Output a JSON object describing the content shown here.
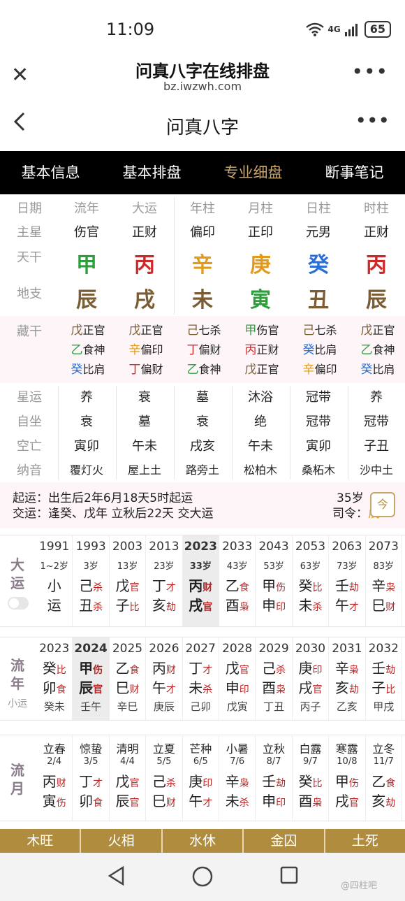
{
  "status": {
    "time": "11:09",
    "signal": "4G",
    "battery": "65"
  },
  "browser": {
    "title": "问真八字在线排盘",
    "url": "bz.iwzwh.com"
  },
  "appbar": {
    "title": "问真八字"
  },
  "tabs": [
    "基本信息",
    "基本排盘",
    "专业细盘",
    "断事笔记"
  ],
  "active_tab": 2,
  "pillars": {
    "header": [
      "日期",
      "流年",
      "大运",
      "年柱",
      "月柱",
      "日柱",
      "时柱"
    ],
    "main_star_label": "主星",
    "main_star": [
      "伤官",
      "正财",
      "偏印",
      "正印",
      "元男",
      "正财"
    ],
    "tiangan_label": "天干",
    "tiangan": [
      {
        "c": "甲",
        "e": "wood"
      },
      {
        "c": "丙",
        "e": "fire"
      },
      {
        "c": "辛",
        "e": "metal"
      },
      {
        "c": "庚",
        "e": "metal"
      },
      {
        "c": "癸",
        "e": "water"
      },
      {
        "c": "丙",
        "e": "fire"
      }
    ],
    "dizhi_label": "地支",
    "dizhi": [
      {
        "c": "辰",
        "e": "earth"
      },
      {
        "c": "戌",
        "e": "earth"
      },
      {
        "c": "未",
        "e": "earth"
      },
      {
        "c": "寅",
        "e": "wood"
      },
      {
        "c": "丑",
        "e": "earth"
      },
      {
        "c": "辰",
        "e": "earth"
      }
    ]
  },
  "canggan": {
    "label": "藏干",
    "cols": [
      [
        {
          "c": "戊",
          "e": "earth",
          "g": "正官"
        },
        {
          "c": "乙",
          "e": "wood",
          "g": "食神"
        },
        {
          "c": "癸",
          "e": "water",
          "g": "比肩"
        }
      ],
      [
        {
          "c": "戊",
          "e": "earth",
          "g": "正官"
        },
        {
          "c": "辛",
          "e": "metal",
          "g": "偏印"
        },
        {
          "c": "丁",
          "e": "fire",
          "g": "偏财"
        }
      ],
      [
        {
          "c": "己",
          "e": "earth",
          "g": "七杀"
        },
        {
          "c": "丁",
          "e": "fire",
          "g": "偏财"
        },
        {
          "c": "乙",
          "e": "wood",
          "g": "食神"
        }
      ],
      [
        {
          "c": "甲",
          "e": "wood",
          "g": "伤官"
        },
        {
          "c": "丙",
          "e": "fire",
          "g": "正财"
        },
        {
          "c": "戊",
          "e": "earth",
          "g": "正官"
        }
      ],
      [
        {
          "c": "己",
          "e": "earth",
          "g": "七杀"
        },
        {
          "c": "癸",
          "e": "water",
          "g": "比肩"
        },
        {
          "c": "辛",
          "e": "metal",
          "g": "偏印"
        }
      ],
      [
        {
          "c": "戊",
          "e": "earth",
          "g": "正官"
        },
        {
          "c": "乙",
          "e": "wood",
          "g": "食神"
        },
        {
          "c": "癸",
          "e": "water",
          "g": "比肩"
        }
      ]
    ]
  },
  "extra_rows": [
    {
      "label": "星运",
      "vals": [
        "养",
        "衰",
        "墓",
        "沐浴",
        "冠带",
        "养"
      ]
    },
    {
      "label": "自坐",
      "vals": [
        "衰",
        "墓",
        "衰",
        "绝",
        "冠带",
        "冠带"
      ]
    },
    {
      "label": "空亡",
      "vals": [
        "寅卯",
        "午未",
        "戌亥",
        "午未",
        "寅卯",
        "子丑"
      ]
    },
    {
      "label": "纳音",
      "vals": [
        "覆灯火",
        "屋上土",
        "路旁土",
        "松柏木",
        "桑柘木",
        "沙中土"
      ]
    }
  ],
  "qiyun": {
    "line1": "起运：出生后2年6月18天5时起运",
    "line2": "交运：逢癸、戊年 立秋后22天 交大运",
    "age": "35岁",
    "siling_label": "司令：",
    "siling_value": "戊",
    "today_icon": "今"
  },
  "dayun": {
    "label1": "大",
    "label2": "运",
    "cols": [
      {
        "year": "1991",
        "age": "1~2岁",
        "g1": "小",
        "g2": "运",
        "s1": "",
        "s2": ""
      },
      {
        "year": "1993",
        "age": "3岁",
        "g1": "己",
        "s1": "杀",
        "g2": "丑",
        "s2": "杀"
      },
      {
        "year": "2003",
        "age": "13岁",
        "g1": "戊",
        "s1": "官",
        "g2": "子",
        "s2": "比"
      },
      {
        "year": "2013",
        "age": "23岁",
        "g1": "丁",
        "s1": "才",
        "g2": "亥",
        "s2": "劫"
      },
      {
        "year": "2023",
        "age": "33岁",
        "g1": "丙",
        "s1": "财",
        "g2": "戌",
        "s2": "官"
      },
      {
        "year": "2033",
        "age": "43岁",
        "g1": "乙",
        "s1": "食",
        "g2": "酉",
        "s2": "枭"
      },
      {
        "year": "2043",
        "age": "53岁",
        "g1": "甲",
        "s1": "伤",
        "g2": "申",
        "s2": "印"
      },
      {
        "year": "2053",
        "age": "63岁",
        "g1": "癸",
        "s1": "比",
        "g2": "未",
        "s2": "杀"
      },
      {
        "year": "2063",
        "age": "73岁",
        "g1": "壬",
        "s1": "劫",
        "g2": "午",
        "s2": "才"
      },
      {
        "year": "2073",
        "age": "83岁",
        "g1": "辛",
        "s1": "枭",
        "g2": "巳",
        "s2": "财"
      }
    ],
    "active": 4
  },
  "liunian": {
    "label1": "流",
    "label2": "年",
    "label3": "小运",
    "cols": [
      {
        "year": "2023",
        "g1": "癸",
        "s1": "比",
        "g2": "卯",
        "s2": "食",
        "x": "癸未"
      },
      {
        "year": "2024",
        "g1": "甲",
        "s1": "伤",
        "g2": "辰",
        "s2": "官",
        "x": "壬午"
      },
      {
        "year": "2025",
        "g1": "乙",
        "s1": "食",
        "g2": "巳",
        "s2": "财",
        "x": "辛巳"
      },
      {
        "year": "2026",
        "g1": "丙",
        "s1": "财",
        "g2": "午",
        "s2": "才",
        "x": "庚辰"
      },
      {
        "year": "2027",
        "g1": "丁",
        "s1": "才",
        "g2": "未",
        "s2": "杀",
        "x": "己卯"
      },
      {
        "year": "2028",
        "g1": "戊",
        "s1": "官",
        "g2": "申",
        "s2": "印",
        "x": "戊寅"
      },
      {
        "year": "2029",
        "g1": "己",
        "s1": "杀",
        "g2": "酉",
        "s2": "枭",
        "x": "丁丑"
      },
      {
        "year": "2030",
        "g1": "庚",
        "s1": "印",
        "g2": "戌",
        "s2": "官",
        "x": "丙子"
      },
      {
        "year": "2031",
        "g1": "辛",
        "s1": "枭",
        "g2": "亥",
        "s2": "劫",
        "x": "乙亥"
      },
      {
        "year": "2032",
        "g1": "壬",
        "s1": "劫",
        "g2": "子",
        "s2": "比",
        "x": "甲戌"
      }
    ],
    "active": 1
  },
  "liuyue": {
    "label1": "流",
    "label2": "月",
    "cols": [
      {
        "term": "立春",
        "date": "2/4",
        "g1": "丙",
        "s1": "财",
        "g2": "寅",
        "s2": "伤"
      },
      {
        "term": "惊蛰",
        "date": "3/5",
        "g1": "丁",
        "s1": "才",
        "g2": "卯",
        "s2": "食"
      },
      {
        "term": "清明",
        "date": "4/4",
        "g1": "戊",
        "s1": "官",
        "g2": "辰",
        "s2": "官"
      },
      {
        "term": "立夏",
        "date": "5/5",
        "g1": "己",
        "s1": "杀",
        "g2": "巳",
        "s2": "财"
      },
      {
        "term": "芒种",
        "date": "6/5",
        "g1": "庚",
        "s1": "印",
        "g2": "午",
        "s2": "才"
      },
      {
        "term": "小暑",
        "date": "7/6",
        "g1": "辛",
        "s1": "枭",
        "g2": "未",
        "s2": "杀"
      },
      {
        "term": "立秋",
        "date": "8/7",
        "g1": "壬",
        "s1": "劫",
        "g2": "申",
        "s2": "印"
      },
      {
        "term": "白露",
        "date": "9/7",
        "g1": "癸",
        "s1": "比",
        "g2": "酉",
        "s2": "枭"
      },
      {
        "term": "寒露",
        "date": "10/8",
        "g1": "甲",
        "s1": "伤",
        "g2": "戌",
        "s2": "官"
      },
      {
        "term": "立冬",
        "date": "11/7",
        "g1": "乙",
        "s1": "食",
        "g2": "亥",
        "s2": "劫"
      }
    ]
  },
  "footer": [
    "木旺",
    "火相",
    "水休",
    "金囚",
    "土死"
  ],
  "watermark": "@四柱吧",
  "colors": {
    "wood": "#2e9d3c",
    "fire": "#cc2a2a",
    "earth": "#7a5c35",
    "metal": "#e39a1a",
    "water": "#2a6fd6",
    "gold": "#b08d3e",
    "active_tab": "#c8a56a"
  }
}
